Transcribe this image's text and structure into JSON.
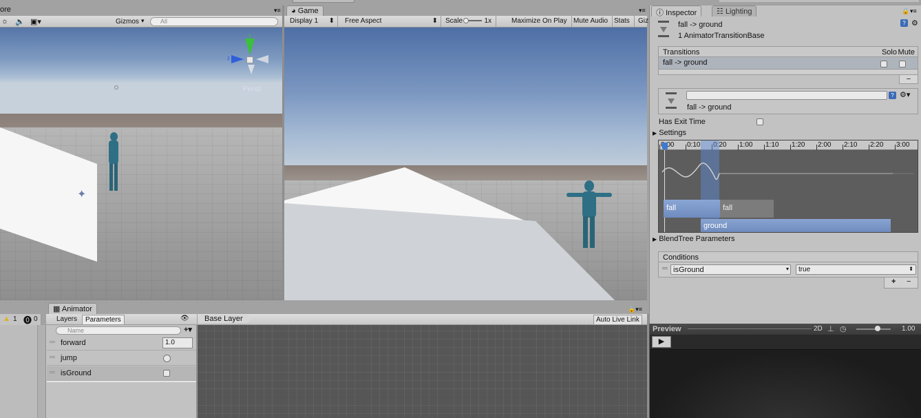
{
  "scene": {
    "tab_partial": "ore",
    "gizmos": "Gizmos",
    "search_placeholder": "All",
    "persp": "Persp",
    "axis_y": "y",
    "axis_z": "z"
  },
  "game": {
    "tab": "Game",
    "display": "Display 1",
    "aspect": "Free Aspect",
    "scale_label": "Scale",
    "scale_value": "1x",
    "maximize": "Maximize On Play",
    "mute": "Mute Audio",
    "stats": "Stats",
    "gizmos_partial": "Giz"
  },
  "inspector": {
    "tab": "Inspector",
    "lighting_tab": "Lighting",
    "title": "fall -> ground",
    "subtitle": "1 AnimatorTransitionBase",
    "transitions": {
      "header": "Transitions",
      "solo": "Solo",
      "mute": "Mute",
      "row": "fall -> ground"
    },
    "transition_name": "fall -> ground",
    "has_exit_time": "Has Exit Time",
    "settings": "Settings",
    "timeline_ticks": [
      "0:00",
      "0:10",
      "0:20",
      "1:00",
      "1:10",
      "1:20",
      "2:00",
      "2:10",
      "2:20",
      "3:00"
    ],
    "clips": {
      "fall_a": "fall",
      "fall_b": "fall",
      "ground": "ground"
    },
    "blendtree": "BlendTree Parameters",
    "conditions": {
      "header": "Conditions",
      "param": "isGround",
      "value": "true"
    },
    "plus": "+",
    "minus": "−"
  },
  "preview": {
    "label": "Preview",
    "mode": "2D",
    "speed": "1.00"
  },
  "animator": {
    "tab": "Animator",
    "warn_count": "1",
    "err_count": "0",
    "layers_tab": "Layers",
    "params_tab": "Parameters",
    "search_placeholder": "Name",
    "layer": "Base Layer",
    "auto_live": "Auto Live Link",
    "params": [
      {
        "name": "forward",
        "value": "1.0"
      },
      {
        "name": "jump",
        "value": ""
      },
      {
        "name": "isGround",
        "value": ""
      }
    ]
  }
}
